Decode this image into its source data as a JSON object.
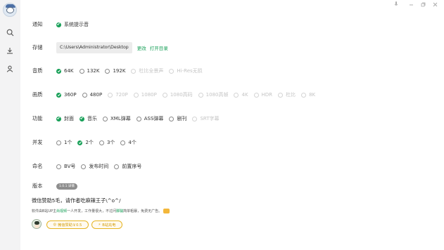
{
  "window": {
    "controls": [
      "mic-icon",
      "minimize-icon",
      "restore-icon",
      "close-icon"
    ]
  },
  "sidebar": {
    "items": [
      {
        "icon": "search-icon"
      },
      {
        "icon": "download-icon"
      },
      {
        "icon": "user-icon"
      }
    ]
  },
  "settings": {
    "notify": {
      "label": "通知",
      "option": "系统提示音"
    },
    "storage": {
      "label": "存储",
      "path": "C:\\Users\\Administrator\\Desktop",
      "change": "更改",
      "open": "打开目录"
    },
    "audio": {
      "label": "音质",
      "options": [
        {
          "text": "64K",
          "selected": true,
          "disabled": false
        },
        {
          "text": "132K",
          "selected": false,
          "disabled": false
        },
        {
          "text": "192K",
          "selected": false,
          "disabled": false
        },
        {
          "text": "杜比全景声",
          "selected": false,
          "disabled": true
        },
        {
          "text": "Hi-Res无损",
          "selected": false,
          "disabled": true
        }
      ]
    },
    "video": {
      "label": "画质",
      "options": [
        {
          "text": "360P",
          "selected": true,
          "disabled": false
        },
        {
          "text": "480P",
          "selected": false,
          "disabled": false
        },
        {
          "text": "720P",
          "selected": false,
          "disabled": true
        },
        {
          "text": "1080P",
          "selected": false,
          "disabled": true
        },
        {
          "text": "1080高码",
          "selected": false,
          "disabled": true
        },
        {
          "text": "1080高帧",
          "selected": false,
          "disabled": true
        },
        {
          "text": "4K",
          "selected": false,
          "disabled": true
        },
        {
          "text": "HDR",
          "selected": false,
          "disabled": true
        },
        {
          "text": "杜比",
          "selected": false,
          "disabled": true
        },
        {
          "text": "8K",
          "selected": false,
          "disabled": true
        }
      ]
    },
    "features": {
      "label": "功能",
      "options": [
        {
          "text": "封面",
          "checked": true,
          "disabled": false
        },
        {
          "text": "音乐",
          "checked": true,
          "disabled": false
        },
        {
          "text": "XML弹幕",
          "checked": false,
          "disabled": false
        },
        {
          "text": "ASS弹幕",
          "checked": false,
          "disabled": false
        },
        {
          "text": "剧刊",
          "checked": false,
          "disabled": false
        },
        {
          "text": "SRT字幕",
          "checked": false,
          "disabled": true
        }
      ]
    },
    "concurrency": {
      "label": "并发",
      "options": [
        {
          "text": "1个",
          "selected": false
        },
        {
          "text": "2个",
          "selected": true
        },
        {
          "text": "3个",
          "selected": false
        },
        {
          "text": "4个",
          "selected": false
        }
      ]
    },
    "naming": {
      "label": "命名",
      "options": [
        {
          "text": "BV号",
          "selected": false
        },
        {
          "text": "发布时间",
          "selected": false
        },
        {
          "text": "前置序号",
          "selected": false
        }
      ]
    },
    "version": {
      "label": "版本",
      "value": "1.0.1 详情"
    }
  },
  "donate": {
    "title": "微信赞助5毛，请作者吃麻辣王子\\^o^/",
    "desc_prefix": "软件由B站UP主",
    "author": "尚视频",
    "desc_mid": "一人开发，工作量很大，不过问",
    "link": "脚騚",
    "desc_suffix": "简单粗暴，免费无广告。",
    "wechat_btn": "微信赞助￥0.5",
    "bili_btn": "B站充电"
  },
  "colors": {
    "accent": "#18a058",
    "warn": "#e6b422",
    "sidebar": "#f3f3f4"
  }
}
